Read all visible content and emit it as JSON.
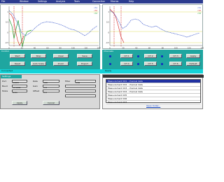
{
  "menubar": {
    "items": [
      "File",
      "Window",
      "Settings",
      "Analysis",
      "Tools",
      "Connection",
      "Macros",
      "Help"
    ]
  },
  "plot_left": {
    "x_ticks": [
      "0",
      "20",
      "40",
      "60",
      "80",
      "100",
      "120",
      "140"
    ],
    "y_ticks": [
      "1",
      "0.5",
      "0",
      "-0.5"
    ],
    "legend": [
      "ch1",
      "ch2",
      "ch3"
    ]
  },
  "plot_right": {
    "x_ticks": [
      "0",
      "20",
      "40",
      "60",
      "80",
      "100",
      "120",
      "140"
    ],
    "y_ticks": [
      "1",
      "0.5",
      "0",
      "-0.5"
    ],
    "legend": [
      "ch1",
      "ch2",
      "ch3"
    ]
  },
  "left_controls": {
    "header": "Control",
    "buttons_row1": [
      "Start",
      "Stop",
      "Clear",
      "Save"
    ],
    "buttons_row2": [
      "Reset",
      "Auto Scale",
      "Zoom",
      "Export"
    ]
  },
  "right_controls": {
    "header": "Channels",
    "buttons_row1": [
      "CH 1",
      "CH 2",
      "CH 3"
    ],
    "buttons_row2": [
      "CH 4",
      "CH 5",
      "CH 6"
    ],
    "side_buttons": [
      "Apply",
      "Default"
    ]
  },
  "status": {
    "left": "Connected",
    "right": "Ready"
  },
  "settings_panel": {
    "tab": "Settings",
    "labels": [
      "Port",
      "Baud",
      "Mode",
      "Rate",
      "Gain",
      "Offset",
      "Filter"
    ],
    "values": [
      "COM3",
      "115200",
      "Auto",
      "100",
      "1.0",
      "0.0",
      "Low"
    ],
    "apply_label": "Apply",
    "cancel_label": "Cancel"
  },
  "list_panel": {
    "rows": [
      "Measurement 001 - channel data",
      "Measurement 002 - channel data",
      "Measurement 003 - channel data",
      "Measurement 004 - channel data",
      "Measurement 005",
      "Measurement 006",
      "Measurement 007"
    ],
    "link": "Open folder..."
  },
  "colors": {
    "menubar": "#2b3b8f",
    "teal": "#1fa6a0",
    "cyan": "#13d3d8",
    "trace_blue": "#3050c8",
    "trace_red": "#d02020",
    "trace_green": "#20a030",
    "trace_yellow": "#e0d020"
  }
}
